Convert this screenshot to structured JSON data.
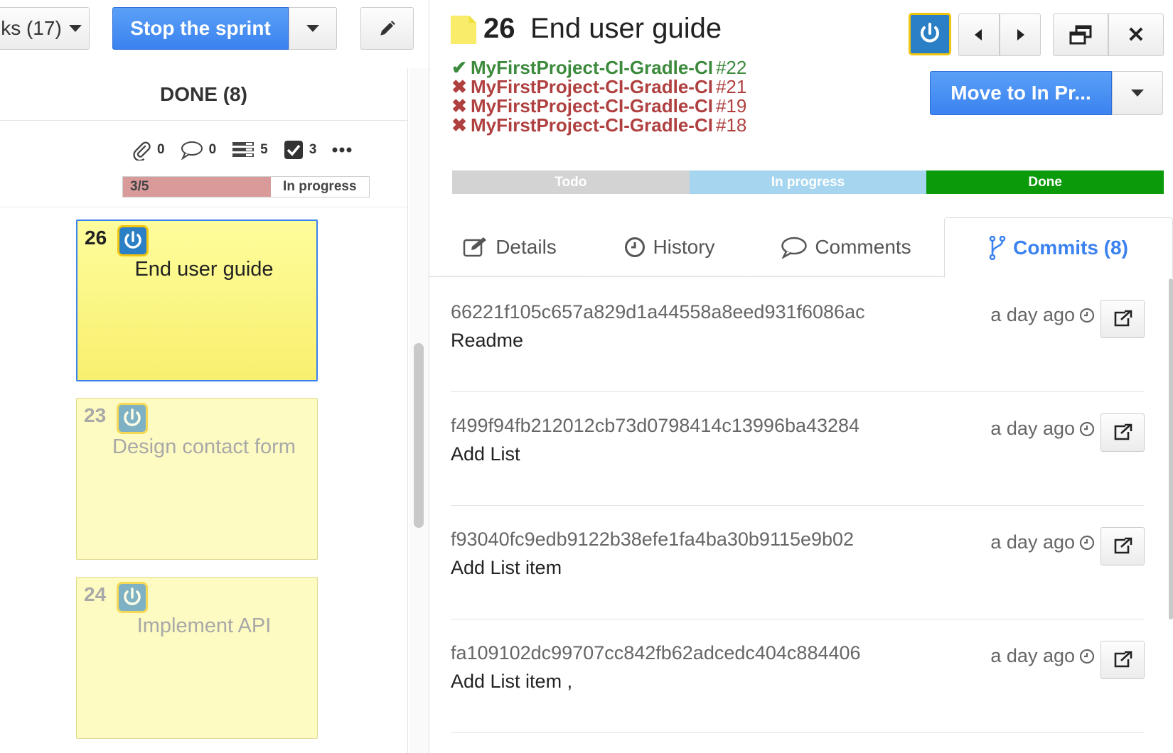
{
  "toolbar": {
    "tasks_label": "ks (17)",
    "stop_label": "Stop the sprint"
  },
  "column": {
    "title": "DONE (8)",
    "stats": {
      "attachments": "0",
      "comments": "0",
      "subtasks": "5",
      "checked": "3"
    },
    "progress": {
      "count": "3/5",
      "fraction": 0.6,
      "status": "In progress"
    }
  },
  "cards": [
    {
      "number": "26",
      "title": "End user guide",
      "active": true
    },
    {
      "number": "23",
      "title": "Design contact form",
      "active": false
    },
    {
      "number": "24",
      "title": "Implement API",
      "active": false
    }
  ],
  "task": {
    "number": "26",
    "title": "End user guide",
    "builds": [
      {
        "status": "ok",
        "name": "MyFirstProject-CI-Gradle-CI",
        "build": "#22"
      },
      {
        "status": "fail",
        "name": "MyFirstProject-CI-Gradle-CI",
        "build": "#21"
      },
      {
        "status": "fail",
        "name": "MyFirstProject-CI-Gradle-CI",
        "build": "#19"
      },
      {
        "status": "fail",
        "name": "MyFirstProject-CI-Gradle-CI",
        "build": "#18"
      }
    ],
    "move_label": "Move to In Pr...",
    "workflow": [
      "Todo",
      "In progress",
      "Done"
    ],
    "current_state": "Done"
  },
  "tabs": [
    {
      "label": "Details",
      "icon": "edit-icon"
    },
    {
      "label": "History",
      "icon": "clock-icon"
    },
    {
      "label": "Comments",
      "icon": "comment-icon"
    },
    {
      "label": "Commits (8)",
      "icon": "branch-icon",
      "active": true
    }
  ],
  "commits": [
    {
      "sha": "66221f105c657a829d1a44558a8eed931f6086ac",
      "message": "Readme",
      "time": "a day ago"
    },
    {
      "sha": "f499f94fb212012cb73d0798414c13996ba43284",
      "message": "Add List",
      "time": "a day ago"
    },
    {
      "sha": "f93040fc9edb9122b38efe1fa4ba30b9115e9b02",
      "message": "Add List item",
      "time": "a day ago"
    },
    {
      "sha": "fa109102dc99707cc842fb62adcedc404c884406",
      "message": "Add List item ,",
      "time": "a day ago"
    }
  ],
  "colors": {
    "primary": "#3b82f0",
    "ok": "#3c8a3c",
    "fail": "#b04040",
    "card_yellow": "#fefd9c",
    "done_green": "#0a9a0a"
  }
}
